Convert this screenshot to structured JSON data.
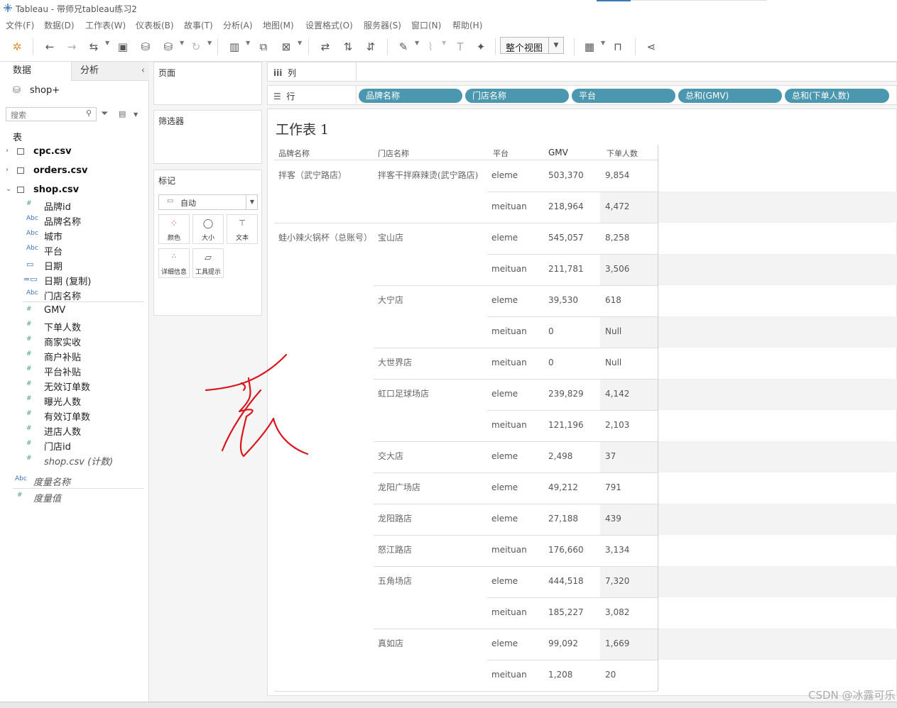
{
  "window": {
    "title": "Tableau - 带师兄tableau练习2"
  },
  "menu": [
    "文件(F)",
    "数据(D)",
    "工作表(W)",
    "仪表板(B)",
    "故事(T)",
    "分析(A)",
    "地图(M)",
    "设置格式(O)",
    "服务器(S)",
    "窗口(N)",
    "帮助(H)"
  ],
  "toolbar": {
    "view_mode": "整个视图"
  },
  "left": {
    "tabs": {
      "data": "数据",
      "analysis": "分析"
    },
    "datasource": "shop+",
    "search_placeholder": "搜索",
    "tables_header": "表",
    "tables": [
      {
        "name": "cpc.csv"
      },
      {
        "name": "orders.csv"
      },
      {
        "name": "shop.csv"
      }
    ],
    "dimensions": [
      {
        "type": "#",
        "name": "品牌id"
      },
      {
        "type": "Abc",
        "name": "品牌名称"
      },
      {
        "type": "Abc",
        "name": "城市"
      },
      {
        "type": "Abc",
        "name": "平台"
      },
      {
        "type": "date",
        "name": "日期"
      },
      {
        "type": "date",
        "name": "日期 (复制)"
      },
      {
        "type": "Abc",
        "name": "门店名称"
      }
    ],
    "measures": [
      {
        "type": "#",
        "name": "GMV"
      },
      {
        "type": "#",
        "name": "下单人数"
      },
      {
        "type": "#",
        "name": "商家实收"
      },
      {
        "type": "#",
        "name": "商户补贴"
      },
      {
        "type": "#",
        "name": "平台补贴"
      },
      {
        "type": "#",
        "name": "无效订单数"
      },
      {
        "type": "#",
        "name": "曝光人数"
      },
      {
        "type": "#",
        "name": "有效订单数"
      },
      {
        "type": "#",
        "name": "进店人数"
      },
      {
        "type": "#",
        "name": "门店id"
      },
      {
        "type": "#",
        "name": "shop.csv (计数)"
      }
    ],
    "extra": [
      {
        "type": "Abc",
        "name": "度量名称"
      },
      {
        "type": "#",
        "name": "度量值"
      }
    ]
  },
  "cards": {
    "pages": "页面",
    "filters": "筛选器",
    "marks": "标记",
    "mark_type": "自动",
    "mark_buttons": [
      "颜色",
      "大小",
      "文本",
      "详细信息",
      "工具提示"
    ]
  },
  "shelves": {
    "columns": "列",
    "rows": "行",
    "row_pills": [
      "品牌名称",
      "门店名称",
      "平台",
      "总和(GMV)",
      "总和(下单人数)"
    ]
  },
  "sheet": {
    "title": "工作表 1",
    "headers": [
      "品牌名称",
      "门店名称",
      "平台",
      "GMV",
      "下单人数"
    ],
    "brands": [
      {
        "name": "拌客（武宁路店）"
      },
      {
        "name": "蛙小辣火锅杯（总账号）"
      }
    ],
    "stores": [
      "拌客干拌麻辣烫(武宁路店)",
      "宝山店",
      "大宁店",
      "大世界店",
      "虹口足球场店",
      "交大店",
      "龙阳广场店",
      "龙阳路店",
      "怒江路店",
      "五角场店",
      "真如店"
    ],
    "rows": [
      {
        "platform": "eleme",
        "gmv": "503,370",
        "orders": "9,854"
      },
      {
        "platform": "meituan",
        "gmv": "218,964",
        "orders": "4,472"
      },
      {
        "platform": "eleme",
        "gmv": "545,057",
        "orders": "8,258"
      },
      {
        "platform": "meituan",
        "gmv": "211,781",
        "orders": "3,506"
      },
      {
        "platform": "eleme",
        "gmv": "39,530",
        "orders": "618"
      },
      {
        "platform": "meituan",
        "gmv": "0",
        "orders": "Null"
      },
      {
        "platform": "meituan",
        "gmv": "0",
        "orders": "Null"
      },
      {
        "platform": "eleme",
        "gmv": "239,829",
        "orders": "4,142"
      },
      {
        "platform": "meituan",
        "gmv": "121,196",
        "orders": "2,103"
      },
      {
        "platform": "eleme",
        "gmv": "2,498",
        "orders": "37"
      },
      {
        "platform": "eleme",
        "gmv": "49,212",
        "orders": "791"
      },
      {
        "platform": "eleme",
        "gmv": "27,188",
        "orders": "439"
      },
      {
        "platform": "meituan",
        "gmv": "176,660",
        "orders": "3,134"
      },
      {
        "platform": "eleme",
        "gmv": "444,518",
        "orders": "7,320"
      },
      {
        "platform": "meituan",
        "gmv": "185,227",
        "orders": "3,082"
      },
      {
        "platform": "eleme",
        "gmv": "99,092",
        "orders": "1,669"
      },
      {
        "platform": "meituan",
        "gmv": "1,208",
        "orders": "20"
      }
    ]
  },
  "annotation": "表",
  "watermark": "CSDN @冰露可乐",
  "colors": {
    "pill": "#4c97b0",
    "accent": "#3b73b9",
    "annotation": "#d9161c"
  }
}
